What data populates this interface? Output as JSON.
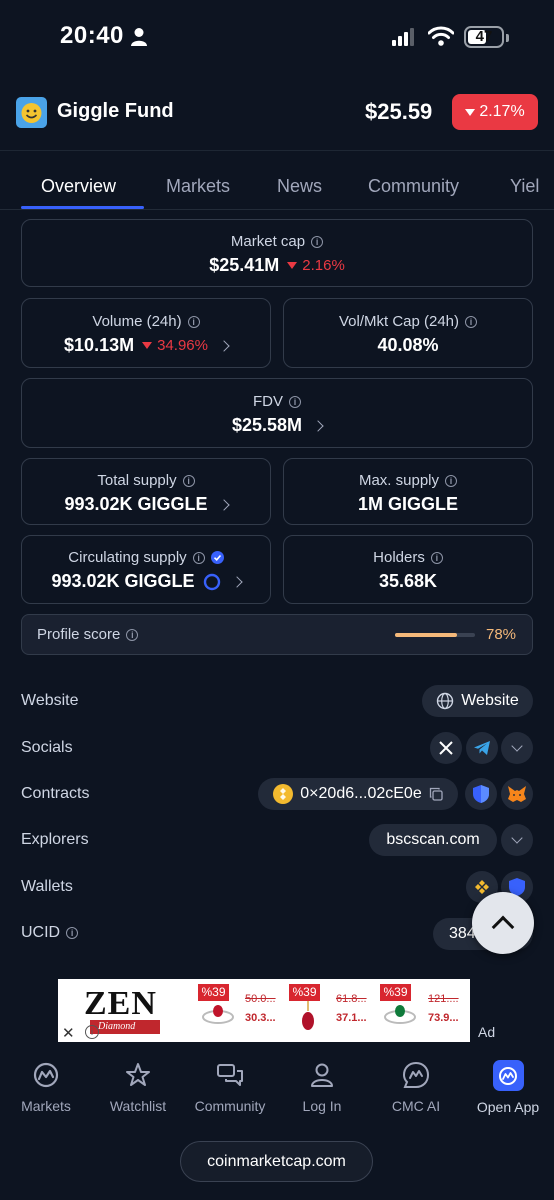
{
  "status_bar": {
    "time": "20:40",
    "battery": "47"
  },
  "header": {
    "coin_name": "Giggle Fund",
    "price": "$25.59",
    "change": "2.17%"
  },
  "tabs": [
    {
      "label": "Overview",
      "active": true
    },
    {
      "label": "Markets"
    },
    {
      "label": "News"
    },
    {
      "label": "Community"
    },
    {
      "label": "Yiel"
    }
  ],
  "stats": {
    "market_cap": {
      "label": "Market cap",
      "value": "$25.41M",
      "change": "2.16%"
    },
    "volume": {
      "label": "Volume (24h)",
      "value": "$10.13M",
      "change": "34.96%"
    },
    "vol_mkt_cap": {
      "label": "Vol/Mkt Cap (24h)",
      "value": "40.08%"
    },
    "fdv": {
      "label": "FDV",
      "value": "$25.58M"
    },
    "total_supply": {
      "label": "Total supply",
      "value": "993.02K GIGGLE"
    },
    "max_supply": {
      "label": "Max. supply",
      "value": "1M GIGGLE"
    },
    "circulating_supply": {
      "label": "Circulating supply",
      "value": "993.02K GIGGLE"
    },
    "holders": {
      "label": "Holders",
      "value": "35.68K"
    }
  },
  "profile_score": {
    "label": "Profile score",
    "value": "78%",
    "fraction": 0.78
  },
  "info_rows": {
    "website": {
      "label": "Website",
      "button": "Website"
    },
    "socials": {
      "label": "Socials"
    },
    "contracts": {
      "label": "Contracts",
      "address": "0×20d6...02cE0e"
    },
    "explorers": {
      "label": "Explorers",
      "button": "bscscan.com"
    },
    "wallets": {
      "label": "Wallets"
    },
    "ucid": {
      "label": "UCID",
      "value": "38470"
    }
  },
  "ad": {
    "brand": "ZEN",
    "sub": "Diamond",
    "label": "Ad",
    "items": [
      {
        "discount": "%39",
        "old": "50.0...",
        "new": "30.3..."
      },
      {
        "discount": "%39",
        "old": "61.8...",
        "new": "37.1..."
      },
      {
        "discount": "%39",
        "old": "121....",
        "new": "73.9..."
      }
    ]
  },
  "bottom_nav": [
    {
      "label": "Markets",
      "icon": "cmc-logo-icon"
    },
    {
      "label": "Watchlist",
      "icon": "star-icon"
    },
    {
      "label": "Community",
      "icon": "chat-bubbles-icon"
    },
    {
      "label": "Log In",
      "icon": "user-icon"
    },
    {
      "label": "CMC AI",
      "icon": "cmc-ai-icon"
    },
    {
      "label": "Open App",
      "icon": "app-icon"
    }
  ],
  "browser": {
    "url": "coinmarketcap.com"
  },
  "colors": {
    "background": "#0d1421",
    "negative": "#ea3943",
    "accent": "#3861fb",
    "score": "#f5b97a"
  }
}
